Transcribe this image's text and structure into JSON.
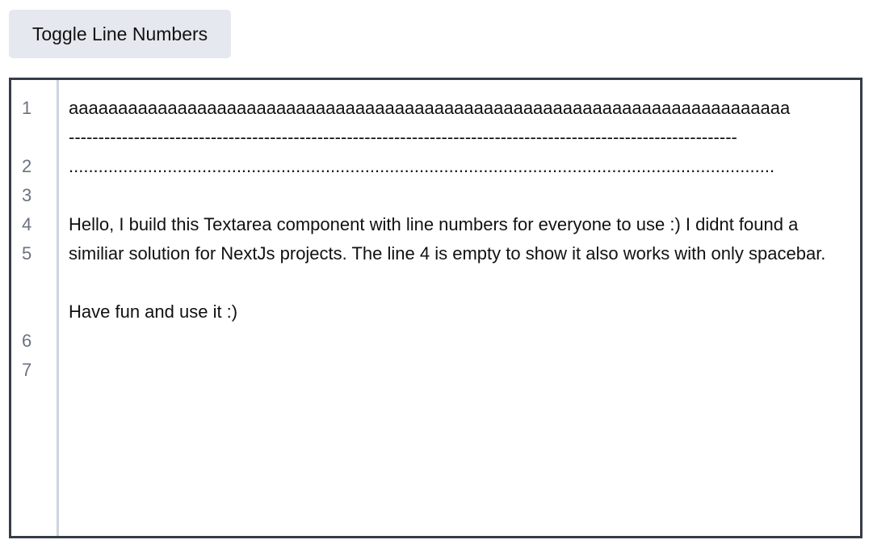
{
  "toolbar": {
    "toggle_label": "Toggle Line Numbers"
  },
  "editor": {
    "line_numbers": [
      "1",
      "",
      "2",
      "3",
      "4",
      "5",
      "",
      "",
      "6",
      "7"
    ],
    "lines": [
      "aaaaaaaaaaaaaaaaaaaaaaaaaaaaaaaaaaaaaaaaaaaaaaaaaaaaaaaaaaaaaaaaaaaaaaaaa",
      "-----------------------------------------------------------------------------------------------------------------",
      "...............................................................................................................................................",
      " ",
      "Hello, I build this Textarea component with line numbers for everyone to use :) I didnt found a similiar solution for NextJs projects. The line 4 is empty to show it also works with only spacebar.",
      "",
      "Have fun and use it :)"
    ]
  },
  "colors": {
    "button_bg": "#e5e8ee",
    "editor_border": "#363d49",
    "gutter_divider": "#ccd5de",
    "line_number_text": "#6b7380",
    "body_text": "#111111"
  }
}
